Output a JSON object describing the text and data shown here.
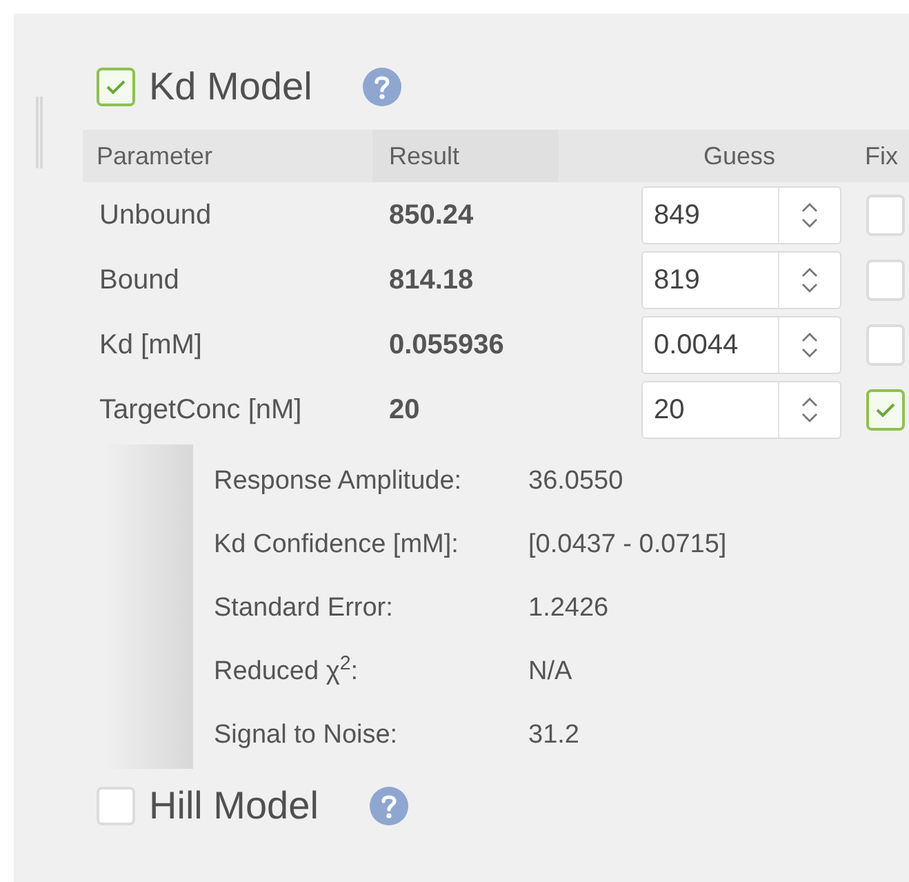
{
  "models": [
    {
      "title": "Kd Model",
      "checked": true,
      "table": {
        "columns": [
          "Parameter",
          "Result",
          "Guess",
          "Fix"
        ],
        "rows": [
          {
            "parameter": "Unbound",
            "result": "850.24",
            "guess": "849",
            "fixed": false
          },
          {
            "parameter": "Bound",
            "result": "814.18",
            "guess": "819",
            "fixed": false
          },
          {
            "parameter": "Kd [mM]",
            "result": "0.055936",
            "guess": "0.0044",
            "fixed": false
          },
          {
            "parameter": "TargetConc [nM]",
            "result": "20",
            "guess": "20",
            "fixed": true
          }
        ]
      },
      "stats": [
        {
          "label": "Response Amplitude:",
          "value": "36.0550"
        },
        {
          "label": "Kd Confidence [mM]:",
          "value": "[0.0437 - 0.0715]"
        },
        {
          "label": "Standard Error:",
          "value": "1.2426"
        },
        {
          "label": "Reduced χ$^{2}$:",
          "value": "N/A"
        },
        {
          "label": "Signal to Noise:",
          "value": "31.2"
        }
      ]
    },
    {
      "title": "Hill Model",
      "checked": false
    }
  ]
}
